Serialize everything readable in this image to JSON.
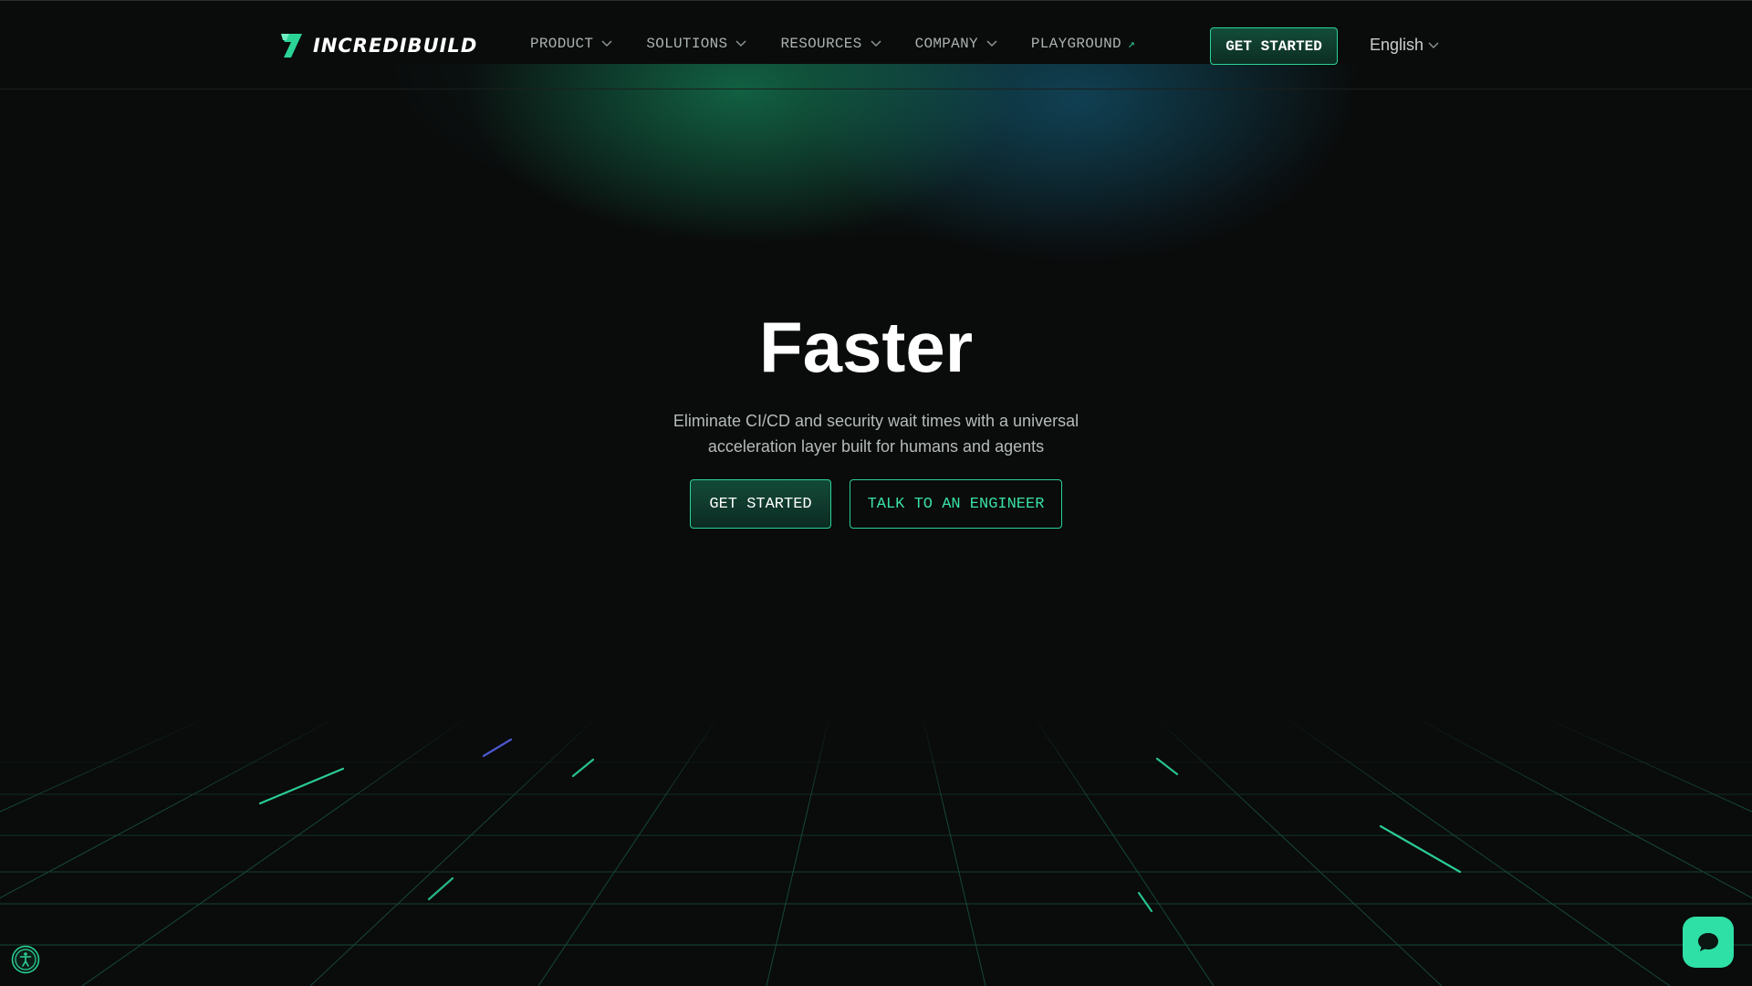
{
  "brand": {
    "name": "INCREDIBUILD",
    "accent": "#2bd396",
    "background": "#0a0b0b"
  },
  "nav": {
    "items": [
      {
        "label": "PRODUCT",
        "icon": "chevron-down-icon"
      },
      {
        "label": "SOLUTIONS",
        "icon": "chevron-down-icon"
      },
      {
        "label": "RESOURCES",
        "icon": "chevron-down-icon"
      },
      {
        "label": "COMPANY",
        "icon": "chevron-down-icon"
      },
      {
        "label": "PLAYGROUND",
        "icon": "external-link-arrow-icon",
        "arrow": "↗"
      }
    ],
    "cta_label": "GET STARTED",
    "language": "English"
  },
  "hero": {
    "title": "Faster",
    "subtitle_line1": "Eliminate CI/CD and security wait times with a universal",
    "subtitle_line2": "acceleration layer built for humans and agents",
    "primary_button": "GET STARTED",
    "secondary_button": "TALK TO AN ENGINEER"
  },
  "widgets": {
    "accessibility_icon": "accessibility-icon",
    "chat_icon": "chat-bubble-icon"
  }
}
